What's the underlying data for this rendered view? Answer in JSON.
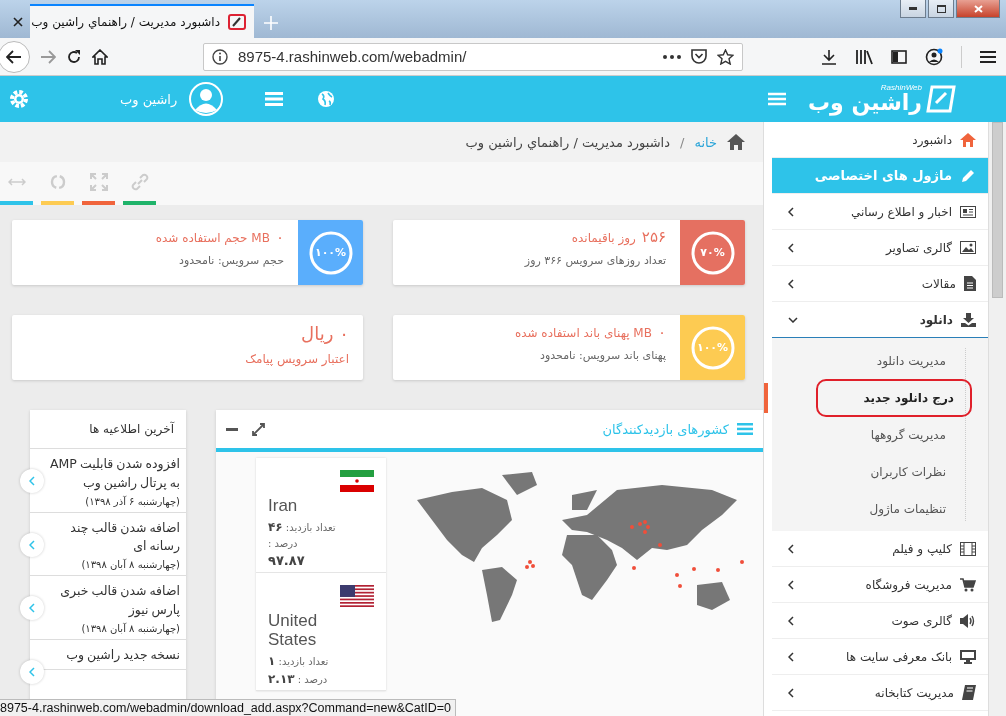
{
  "browser": {
    "tab_title": "داشبورد مديريت / راهنماي راشين وب",
    "url": "8975-4.rashinweb.com/webadmin/"
  },
  "header": {
    "logo_text": "راشین وب",
    "logo_subtext": "RashinWeb",
    "user_name": "راشين وب"
  },
  "breadcrumb": {
    "home": "خانه",
    "separator": "/",
    "current": "داشبورد مديريت / راهنماي راشين وب"
  },
  "stats": [
    {
      "kind": "gauge",
      "value": "۲۵۶",
      "title": "روز باقیمانده",
      "subtitle": "تعداد روزهای سرویس ۳۶۶ روز",
      "gauge_label": "۷۰%",
      "color": "#e57061"
    },
    {
      "kind": "gauge",
      "value": "۰",
      "title": "MB حجم استفاده شده",
      "subtitle": "حجم سرویس: نامحدود",
      "gauge_label": "۱۰۰%",
      "color": "#5aaefc"
    },
    {
      "kind": "gauge",
      "value": "۰",
      "title": "MB پهنای باند استفاده شده",
      "subtitle": "پهنای باند سرویس: نامحدود",
      "gauge_label": "۱۰۰%",
      "color": "#fdcb52"
    },
    {
      "kind": "plain",
      "value": "۰",
      "title": "ریال",
      "subtitle": "اعتبار سرویس پیامک"
    }
  ],
  "news": {
    "title": "آخرین اطلاعیه ها",
    "items": [
      {
        "title": "افزوده شدن قابلیت AMP به پرتال راشین وب",
        "date": "(چهارشنبه ۶ آذر ۱۳۹۸)"
      },
      {
        "title": "اضافه شدن قالب چند رسانه ای",
        "date": "(چهارشنبه ۸ آبان ۱۳۹۸)"
      },
      {
        "title": "اضافه شدن قالب خبری پارس نیوز",
        "date": "(چهارشنبه ۸ آبان ۱۳۹۸)"
      },
      {
        "title": "نسخه جدید راشین وب"
      }
    ]
  },
  "visitors": {
    "title": "کشورهای بازدیدکنندگان",
    "countries": [
      {
        "name": "Iran",
        "visits_label": "تعداد بازدید:",
        "visits": "۴۶",
        "percent_label": "درصد :",
        "percent": "۹۷.۸۷"
      },
      {
        "name": "United States",
        "visits_label": "تعداد بازدید:",
        "visits": "۱",
        "percent_label": "درصد :",
        "percent": "۲.۱۳"
      }
    ]
  },
  "sidebar": {
    "items": [
      {
        "label": "داشبورد",
        "selected": false
      },
      {
        "label": "ماژول های اختصاصی",
        "selected": true
      },
      {
        "label": "اخبار و اطلاع رساني",
        "selected": false,
        "expanded": false
      },
      {
        "label": "گالری تصاویر",
        "selected": false,
        "expanded": false
      },
      {
        "label": "مقالات",
        "selected": false,
        "expanded": false
      },
      {
        "label": "دانلود",
        "selected": false,
        "expanded": true,
        "children": [
          {
            "label": "مدیریت دانلود",
            "selected": false
          },
          {
            "label": "درج دانلود جدید",
            "selected": true
          },
          {
            "label": "مدیریت گروهها",
            "selected": false
          },
          {
            "label": "نظرات کاربران",
            "selected": false
          },
          {
            "label": "تنظیمات ماژول",
            "selected": false
          }
        ]
      },
      {
        "label": "کلیپ و فیلم",
        "selected": false,
        "expanded": false
      },
      {
        "label": "مدیریت فروشگاه",
        "selected": false,
        "expanded": false
      },
      {
        "label": "گالری صوت",
        "selected": false,
        "expanded": false
      },
      {
        "label": "بانک معرفی سایت ها",
        "selected": false,
        "expanded": false
      },
      {
        "label": "مدیریت کتابخانه",
        "selected": false,
        "expanded": false
      }
    ]
  },
  "status_bar": "8975-4.rashinweb.com/webadmin/download_add.aspx?Command=new&CatID=0"
}
